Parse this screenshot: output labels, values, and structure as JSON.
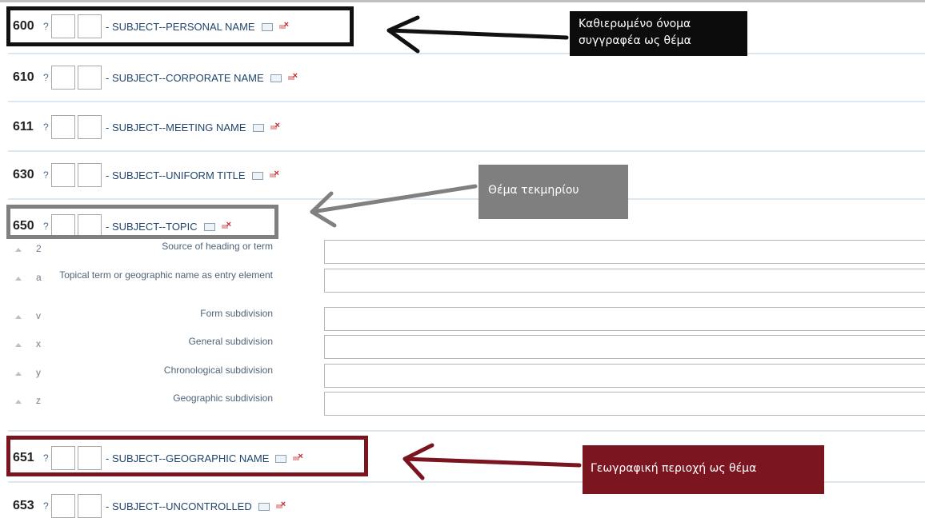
{
  "fields": [
    {
      "tag": "600",
      "help": "?",
      "label": "- SUBJECT--PERSONAL NAME"
    },
    {
      "tag": "610",
      "help": "?",
      "label": "- SUBJECT--CORPORATE NAME"
    },
    {
      "tag": "611",
      "help": "?",
      "label": "- SUBJECT--MEETING NAME"
    },
    {
      "tag": "630",
      "help": "?",
      "label": "- SUBJECT--UNIFORM TITLE"
    },
    {
      "tag": "650",
      "help": "?",
      "label": "- SUBJECT--TOPIC"
    },
    {
      "tag": "651",
      "help": "?",
      "label": "- SUBJECT--GEOGRAPHIC NAME"
    },
    {
      "tag": "653",
      "help": "?",
      "label": "- SUBJECT--UNCONTROLLED"
    }
  ],
  "subfields": [
    {
      "code": "2",
      "label": "Source of heading or term",
      "value": ""
    },
    {
      "code": "a",
      "label": "Topical term or geographic name as entry element",
      "value": ""
    },
    {
      "code": "v",
      "label": "Form subdivision",
      "value": ""
    },
    {
      "code": "x",
      "label": "General subdivision",
      "value": ""
    },
    {
      "code": "y",
      "label": "Chronological subdivision",
      "value": ""
    },
    {
      "code": "z",
      "label": "Geographic subdivision",
      "value": ""
    }
  ],
  "annotations": {
    "personal_name_note_line1": "Καθιερωμένο όνομα",
    "personal_name_note_line2": "συγγραφέα ως θέμα",
    "topic_note": "Θέμα τεκμηρίου",
    "geographic_note": "Γεωγραφική περιοχή ως θέμα"
  },
  "colors": {
    "box_600": "#111111",
    "box_650": "#808080",
    "box_651": "#7a1520",
    "note_600_bg": "#0c0c0c",
    "note_650_bg": "#7f7f7f",
    "note_651_bg": "#7b1520",
    "label_color": "#21456b"
  }
}
